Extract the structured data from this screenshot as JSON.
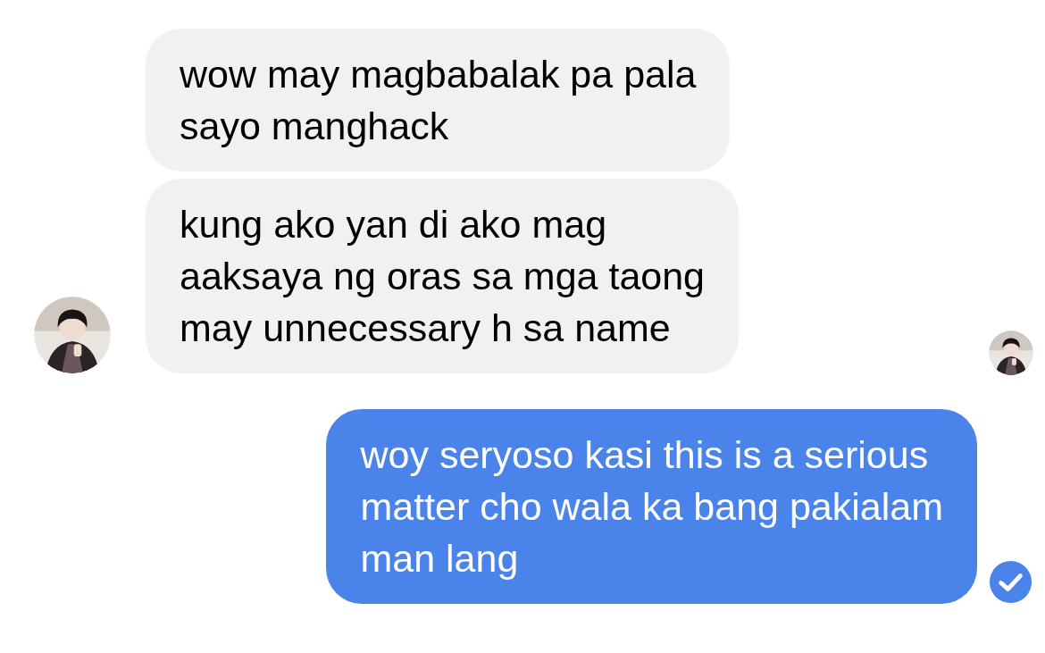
{
  "messages": [
    {
      "kind": "received",
      "text": "wow may magbabalak pa pala\nsayo manghack",
      "show_avatar": false,
      "seen": false,
      "delivered": false
    },
    {
      "kind": "received",
      "text": "kung ako yan di ako mag\naaksaya ng oras sa mga taong\nmay unnecessary h sa name",
      "show_avatar": true,
      "seen": true,
      "delivered": false
    },
    {
      "kind": "sent",
      "text": "woy seryoso kasi this is a serious\nmatter cho wala ka bang pakialam\nman lang",
      "seen": false,
      "delivered": true
    }
  ]
}
